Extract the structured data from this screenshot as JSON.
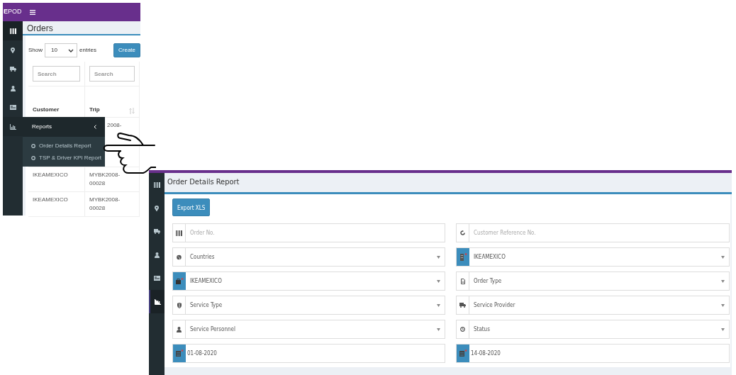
{
  "orders_screen": {
    "brand": "**E**POD",
    "sidebar": [
      {
        "selected": true
      },
      {
        "selected": false
      },
      {
        "selected": false
      },
      {
        "selected": false
      },
      {
        "selected": false
      },
      {
        "selected": false
      }
    ],
    "page_title": "Orders",
    "length": {
      "label_before": "Show",
      "value": "10",
      "label_after": "entries"
    },
    "create_button": "Create",
    "search_fields": [
      {
        "placeholder": "Search"
      },
      {
        "placeholder": "Search"
      }
    ],
    "columns": [
      "Customer",
      "Trip"
    ],
    "rows": [
      {
        "trip": "2008-"
      },
      {
        "customer": "IKEAMEXICO",
        "trip": "MYBK2008-00028"
      },
      {
        "customer": "IKEAMEXICO",
        "trip": "MYBK2008-00028"
      }
    ],
    "reports_menu": {
      "label": "Reports",
      "expanded": true,
      "items": [
        "Order Details Report",
        "TSP & Driver KPI Report"
      ]
    }
  },
  "report_screen": {
    "sidebar": [
      {
        "selected": false
      },
      {
        "selected": false
      },
      {
        "selected": false
      },
      {
        "selected": false
      },
      {
        "selected": false
      },
      {
        "selected": true
      }
    ],
    "page_title": "Order Details Report",
    "export_button": "Export XLS",
    "fields": [
      {
        "kind": "text",
        "placeholder": "Order No.",
        "required": false
      },
      {
        "kind": "text",
        "placeholder": "Customer Reference No.",
        "required": false
      },
      {
        "kind": "select",
        "value": "Countries",
        "required": false
      },
      {
        "kind": "select",
        "value": "IKEAMEXICO",
        "required": true
      },
      {
        "kind": "select",
        "value": "IKEAMEXICO",
        "required": true
      },
      {
        "kind": "select",
        "value": "Order Type",
        "required": false
      },
      {
        "kind": "select",
        "value": "Service Type",
        "required": false
      },
      {
        "kind": "select",
        "value": "Service Provider",
        "required": false
      },
      {
        "kind": "select",
        "value": "Service Personnel",
        "required": false
      },
      {
        "kind": "select",
        "value": "Status",
        "required": false
      },
      {
        "kind": "date",
        "value": "01-08-2020",
        "required": true
      },
      {
        "kind": "date",
        "value": "14-08-2020",
        "required": true
      }
    ]
  }
}
